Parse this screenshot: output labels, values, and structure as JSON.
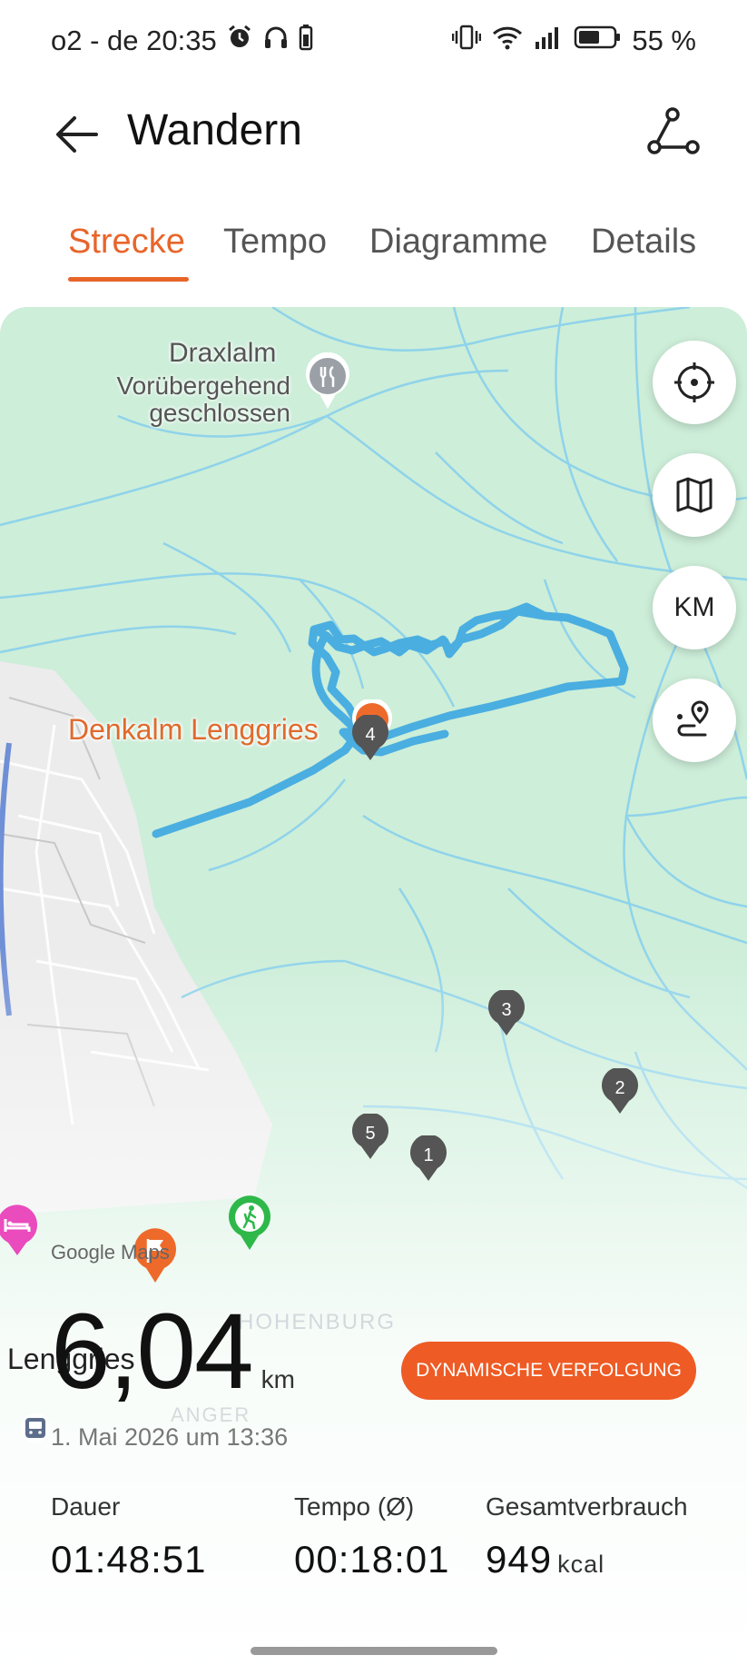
{
  "status_bar": {
    "carrier_time": "o2 - de 20:35",
    "battery": "55 %"
  },
  "header": {
    "title": "Wandern"
  },
  "tabs": [
    {
      "label": "Strecke",
      "active": true
    },
    {
      "label": "Tempo",
      "active": false
    },
    {
      "label": "Diagramme",
      "active": false
    },
    {
      "label": "Details",
      "active": false
    }
  ],
  "map": {
    "fab_km": "KM",
    "poi_name": "Draxlalm",
    "poi_status_line1": "Vorübergehend",
    "poi_status_line2": "geschlossen",
    "highlight_place": "Denkalm Lenggries",
    "town": "Lenggries",
    "area_label_1": "HOHENBURG",
    "area_label_2": "ANGER",
    "markers": [
      "1",
      "2",
      "3",
      "4",
      "5"
    ],
    "attribution": "Google Maps",
    "colors": {
      "route": "#4aaee0",
      "accent": "#e8652a",
      "start_marker": "#2eb84a"
    }
  },
  "summary": {
    "distance_value": "6,04",
    "distance_unit": "km",
    "dynamic_button": "DYNAMISCHE VERFOLGUNG",
    "date": "1. Mai 2026 um 13:36",
    "stats": [
      {
        "label": "Dauer",
        "value": "01:48:51",
        "unit": ""
      },
      {
        "label": "Tempo (Ø)",
        "value": "00:18:01",
        "unit": ""
      },
      {
        "label": "Gesamtverbrauch",
        "value": "949",
        "unit": "kcal"
      }
    ]
  }
}
